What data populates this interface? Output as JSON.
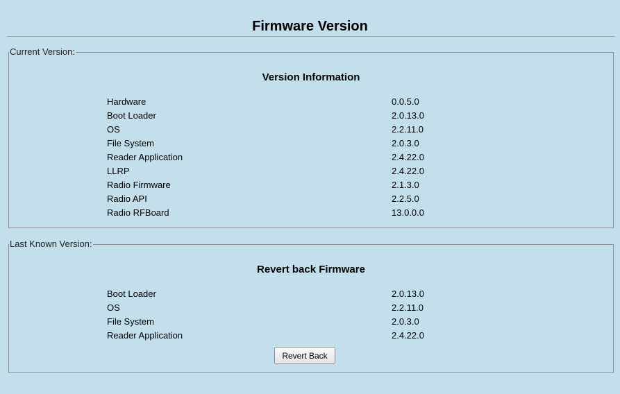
{
  "page": {
    "title": "Firmware Version"
  },
  "current": {
    "legend": "Current Version:",
    "heading": "Version Information",
    "rows": [
      {
        "label": "Hardware",
        "value": "0.0.5.0"
      },
      {
        "label": "Boot Loader",
        "value": "2.0.13.0"
      },
      {
        "label": "OS",
        "value": "2.2.11.0"
      },
      {
        "label": "File System",
        "value": "2.0.3.0"
      },
      {
        "label": "Reader Application",
        "value": "2.4.22.0"
      },
      {
        "label": "LLRP",
        "value": "2.4.22.0"
      },
      {
        "label": "Radio Firmware",
        "value": "2.1.3.0"
      },
      {
        "label": "Radio API",
        "value": "2.2.5.0"
      },
      {
        "label": "Radio RFBoard",
        "value": "13.0.0.0"
      }
    ]
  },
  "last_known": {
    "legend": "Last Known Version:",
    "heading": "Revert back Firmware",
    "rows": [
      {
        "label": "Boot Loader",
        "value": "2.0.13.0"
      },
      {
        "label": "OS",
        "value": "2.2.11.0"
      },
      {
        "label": "File System",
        "value": "2.0.3.0"
      },
      {
        "label": "Reader Application",
        "value": "2.4.22.0"
      }
    ],
    "revert_button_label": "Revert Back"
  },
  "colors": {
    "background": "#c2dfeb",
    "border": "#8a8f94"
  }
}
